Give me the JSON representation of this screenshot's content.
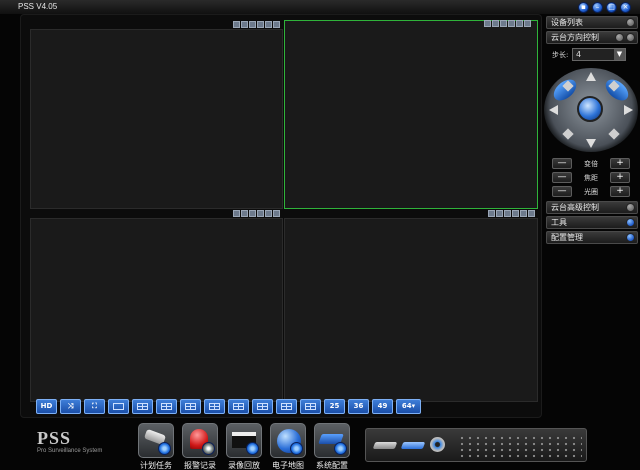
{
  "window": {
    "title": "PSS  V4.05",
    "buttons": [
      "restore-icon",
      "minimize-icon",
      "maximize-icon",
      "close-icon"
    ]
  },
  "video": {
    "selected_pane": 2,
    "layout_buttons": [
      "HD",
      "",
      "",
      "",
      "",
      "",
      "",
      "",
      "",
      "",
      "",
      "",
      "25",
      "36",
      "49",
      "64▾"
    ]
  },
  "right_panel": {
    "device_list": "设备列表",
    "ptz_control": "云台方向控制",
    "step_label": "步长:",
    "step_value": "4",
    "zoom_label": "变倍",
    "focus_label": "焦距",
    "iris_label": "光圈",
    "minus": "—",
    "plus": "+",
    "ptz_advanced": "云台高级控制",
    "tools": "工具",
    "config": "配置管理"
  },
  "logo": {
    "name": "PSS",
    "subtitle": "Pro Surveillance System"
  },
  "toolbar": {
    "schedule": "计划任务",
    "alarm": "报警记录",
    "playback": "录像回放",
    "emap": "电子地图",
    "sysconfig": "系统配置"
  },
  "colors": {
    "selected_pane_border": "#2fb33a",
    "accent_blue": "#2d73d8"
  }
}
